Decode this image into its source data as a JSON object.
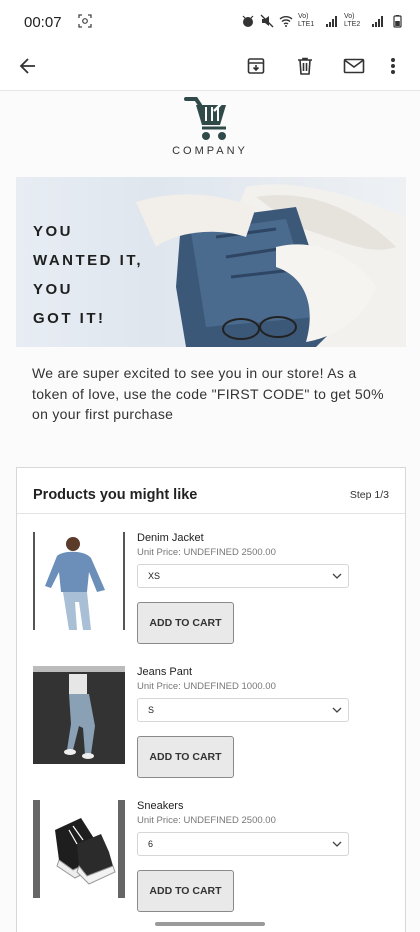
{
  "status_bar": {
    "time": "00:07",
    "sim1": "Vo) LTE1",
    "sim2": "Vo) LTE2"
  },
  "email": {
    "company": "COMPANY",
    "hero_lines": [
      "YOU",
      "WANTED IT,",
      "YOU",
      "GOT IT!"
    ],
    "intro": "We are super excited to see you in our store! As a token of love, use the code \"FIRST CODE\" to get 50% on your first purchase",
    "products_title": "Products you might like",
    "step": "Step 1/3",
    "products": [
      {
        "name": "Denim Jacket",
        "price": "Unit Price: UNDEFINED 2500.00",
        "size": "XS",
        "button": "ADD TO CART"
      },
      {
        "name": "Jeans Pant",
        "price": "Unit Price: UNDEFINED 1000.00",
        "size": "S",
        "button": "ADD TO CART"
      },
      {
        "name": "Sneakers",
        "price": "Unit Price: UNDEFINED 2500.00",
        "size": "6",
        "button": "ADD TO CART"
      }
    ]
  }
}
